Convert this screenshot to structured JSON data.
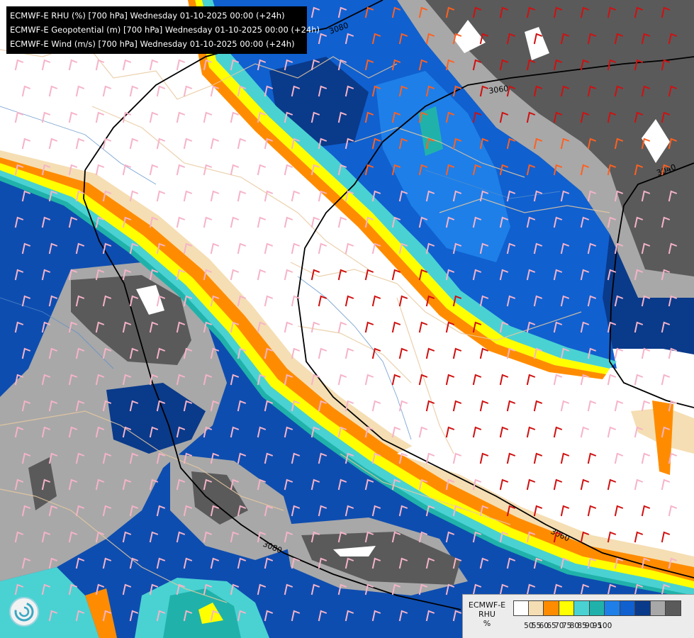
{
  "header": {
    "lines": [
      "ECMWF-E RHU (%) [700 hPa] Wednesday 01-10-2025 00:00 (+24h)",
      "ECMWF-E Geopotential (m) [700 hPa] Wednesday 01-10-2025 00:00 (+24h)",
      "ECMWF-E Wind (m/s) [700 hPa] Wednesday 01-10-2025 00:00 (+24h)"
    ]
  },
  "legend": {
    "label_line1": "ECMWF-E",
    "label_line2": "RHU",
    "label_line3": "%",
    "colors": [
      "#ffffff",
      "#f5deb3",
      "#ff8c00",
      "#ffff00",
      "#4ad2d2",
      "#20b2aa",
      "#1e7fe8",
      "#1060d0",
      "#0a3a8a",
      "#a8a8a8",
      "#5a5a5a"
    ],
    "ticks": [
      "50",
      "55",
      "60",
      "65",
      "70",
      "75",
      "80",
      "85",
      "90",
      "95",
      "100"
    ]
  },
  "contours": {
    "labels": [
      "3080",
      "3060",
      "3040",
      "3060",
      "3080"
    ]
  },
  "icons": {
    "logo": "swirl-logo-icon"
  }
}
